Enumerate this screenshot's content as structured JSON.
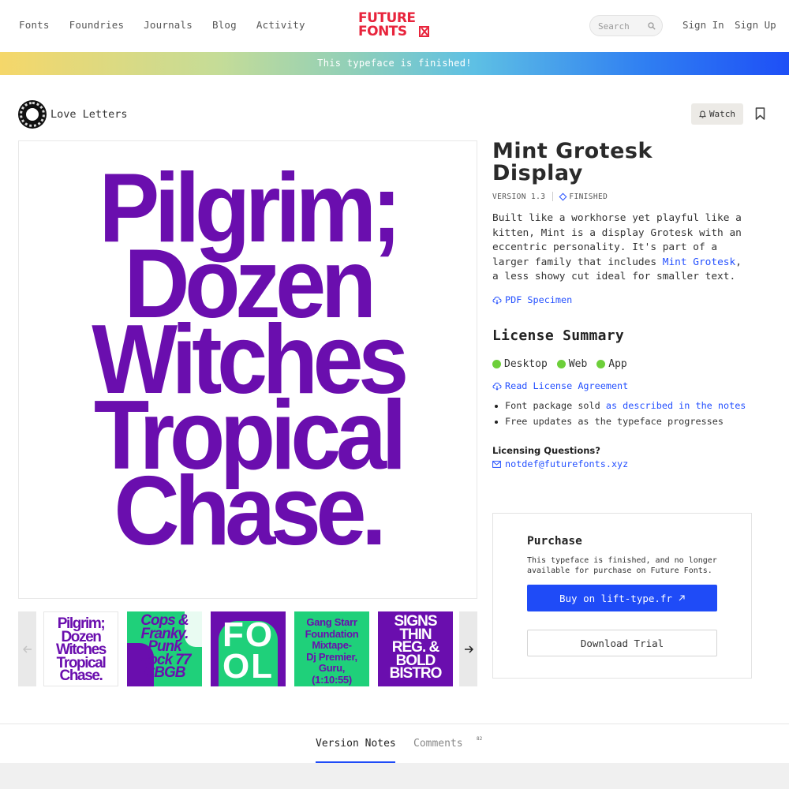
{
  "nav": {
    "items": [
      "Fonts",
      "Foundries",
      "Journals",
      "Blog",
      "Activity"
    ]
  },
  "logo": {
    "line1": "FUTURE",
    "line2": "FONTS"
  },
  "search": {
    "placeholder": "Search"
  },
  "auth": {
    "sign_in": "Sign In",
    "sign_up": "Sign Up"
  },
  "banner": {
    "text": "This typeface is finished!"
  },
  "foundry": {
    "name": "Love Letters"
  },
  "actions": {
    "watch": "Watch"
  },
  "hero": {
    "lines": [
      "Pilgrim;",
      "Dozen",
      "Witches",
      "Tropical",
      "Chase."
    ]
  },
  "thumbnails": [
    {
      "text": [
        "Pilgrim;",
        "Dozen",
        "Witches",
        "Tropical",
        "Chase."
      ]
    },
    {
      "text": [
        "Cops &",
        "Franky.",
        "Punk",
        "Rock 77",
        "CBGB"
      ]
    },
    {
      "text": [
        "FO",
        "OL"
      ]
    },
    {
      "text": [
        "Gang Starr",
        "Foundation",
        "Mixtape-",
        "Dj Premier,",
        "Guru,",
        "(1:10:55)"
      ]
    },
    {
      "text": [
        "SIGNS",
        "THIN",
        "REG. &",
        "BOLD",
        "BISTRO"
      ]
    }
  ],
  "typeface": {
    "title_line1": "Mint Grotesk",
    "title_line2": "Display",
    "version": "VERSION 1.3",
    "status": "FINISHED",
    "description_part1": "Built like a workhorse yet playful like a kitten, Mint is a display Grotesk with an eccentric personality. It's part of a larger family that includes ",
    "description_link": "Mint Grotesk",
    "description_part2": ", a less showy cut ideal for smaller text.",
    "pdf_specimen": "PDF Specimen"
  },
  "license": {
    "title": "License Summary",
    "types": [
      "Desktop",
      "Web",
      "App"
    ],
    "read_agreement": "Read License Agreement",
    "bullet1_prefix": "Font package sold ",
    "bullet1_link": "as described in the notes",
    "bullet2": "Free updates as the typeface progresses",
    "questions_label": "Licensing Questions?",
    "email": "notdef@futurefonts.xyz"
  },
  "purchase": {
    "title": "Purchase",
    "note": "This typeface is finished, and no longer available for purchase on Future Fonts.",
    "buy_label": "Buy on lift-type.fr",
    "trial_label": "Download Trial"
  },
  "tabs": {
    "version_notes": "Version Notes",
    "comments": "Comments",
    "comments_count": "82"
  },
  "colors": {
    "accent": "#1f4bf7",
    "specimen_purple": "#6a0eae",
    "logo_red": "#e8243c",
    "license_green": "#6dcf3a",
    "thumb_green": "#1fd07a"
  }
}
